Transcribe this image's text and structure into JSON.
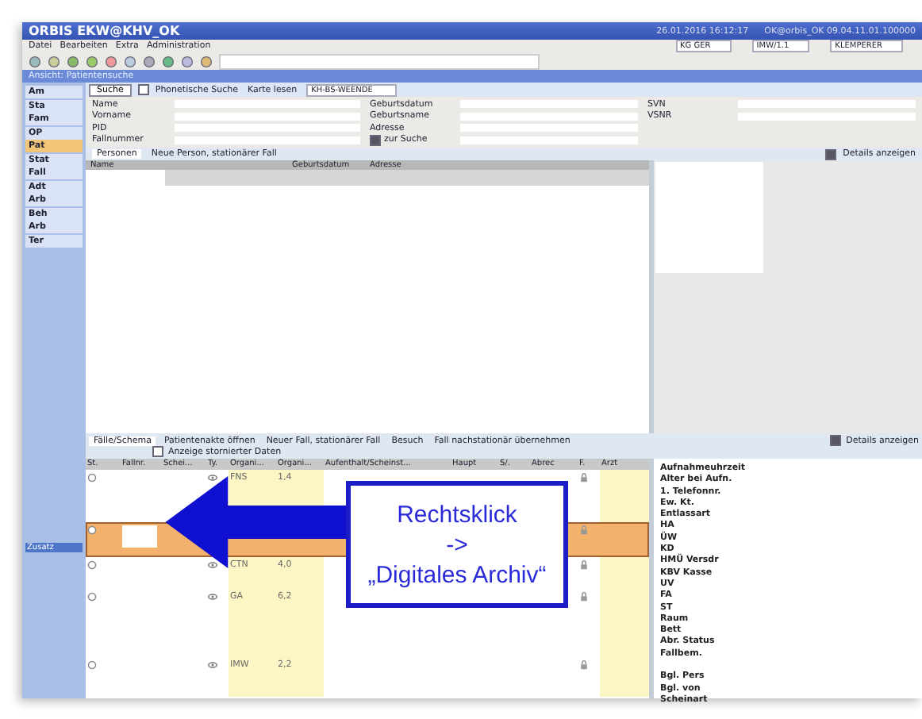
{
  "window": {
    "title": "ORBIS EKW@KHV_OK",
    "info": [
      "26.01.2016 16:12:17",
      "OK@orbis_OK 09.04.11.01.100000"
    ]
  },
  "menu": [
    "Datei",
    "Bearbeiten",
    "Extra",
    "Administration"
  ],
  "toolbar": {
    "combos": [
      "KG GER",
      "IMW/1.1",
      "KLEMPERER"
    ]
  },
  "view_title": "Ansicht: Patientensuche",
  "search_bar": {
    "search_button": "Suche",
    "phonetic": {
      "label": "Phonetische Suche",
      "checked": false
    },
    "card": "Karte lesen",
    "site": "KH-BS-WEENDE"
  },
  "sidebar": {
    "items": [
      {
        "label": "Am",
        "selected": false
      },
      {
        "label": "Sta",
        "selected": false
      },
      {
        "label": "Fam",
        "selected": false
      },
      {
        "label": "OP",
        "selected": false
      },
      {
        "label": "Pat",
        "selected": true
      },
      {
        "label": "Stat",
        "selected": false
      },
      {
        "label": "Fall",
        "selected": false
      },
      {
        "label": "Adt",
        "selected": false
      },
      {
        "label": "Arb",
        "selected": false
      },
      {
        "label": "Beh",
        "selected": false
      },
      {
        "label": "Arb",
        "selected": false
      },
      {
        "label": "Ter",
        "selected": false
      }
    ],
    "lower_item": "Zusatz"
  },
  "form": {
    "left": [
      "Name",
      "Vorname",
      "PID",
      "Fallnummer"
    ],
    "middle": [
      "Geburtsdatum",
      "Geburtsname",
      "Adresse"
    ],
    "zur_suche": {
      "label": "zur Suche",
      "checked": true
    },
    "right": [
      "SVN",
      "VSNR"
    ]
  },
  "persons": {
    "tab": "Personen",
    "new_button": "Neue Person, stationärer Fall",
    "details": {
      "label": "Details anzeigen",
      "checked": true
    },
    "columns": [
      "Name",
      "Geburtsdatum",
      "Adresse"
    ]
  },
  "cases": {
    "tab": "Fälle/Schema",
    "actions": [
      "Patientenakte öffnen",
      "Neuer Fall, stationärer Fall",
      "Besuch",
      "Fall nachstationär übernehmen"
    ],
    "cancelled": {
      "label": "Anzeige stornierter Daten",
      "checked": false
    },
    "details": {
      "label": "Details anzeigen",
      "checked": true
    },
    "columns": [
      "St.",
      "Fallnr.",
      "Schei...",
      "Ty.",
      "Organi...",
      "Organi...",
      "Aufenthalt/Scheinst...",
      "Haupt",
      "S/.",
      "Abrec",
      "F.",
      "Arzt"
    ],
    "rows": [
      {
        "org": "FNS",
        "value": "1,4",
        "selected": false
      },
      {
        "org": "",
        "value": "",
        "selected": true
      },
      {
        "org": "CTN",
        "value": "4,0",
        "selected": false
      },
      {
        "org": "GA",
        "value": "6,2",
        "selected": false
      },
      {
        "org": "IMW",
        "value": "2,2",
        "selected": false
      }
    ],
    "detail_labels": [
      "Aufnahmeuhrzeit",
      "Alter bei Aufn.",
      "1. Telefonnr.",
      "Ew. Kt.",
      "Entlassart",
      "HA",
      "ÜW",
      "KD",
      "HMÜ Versdr",
      "KBV Kasse",
      "UV",
      "FA",
      "ST",
      "Raum",
      "Bett",
      "Abr. Status",
      "Fallbem.",
      "Bgl. Pers",
      "Bgl. von",
      "Scheinart"
    ]
  },
  "callout": [
    "Rechtsklick",
    "->",
    "„Digitales Archiv“"
  ]
}
